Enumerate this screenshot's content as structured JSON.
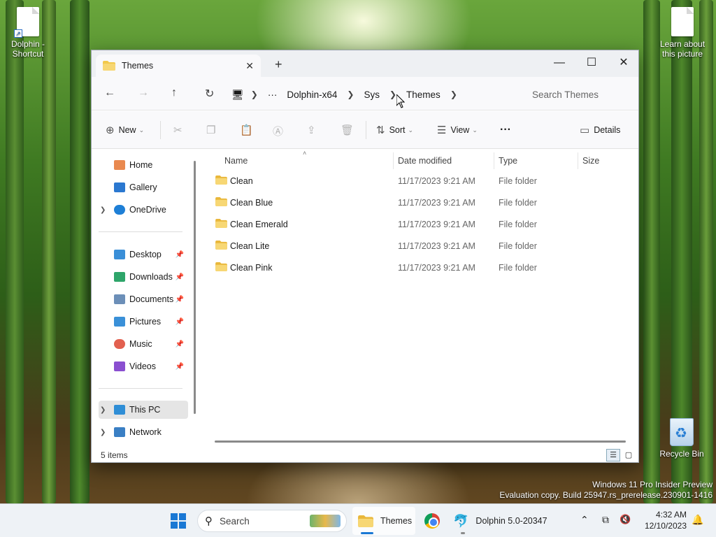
{
  "desktop": {
    "icons": [
      {
        "label": "Dolphin - Shortcut"
      },
      {
        "label": "Learn about this picture"
      }
    ],
    "recycle_bin": "Recycle Bin",
    "watermark_line1": "Windows 11 Pro Insider Preview",
    "watermark_line2": "Evaluation copy. Build 25947.rs_prerelease.230901-1416"
  },
  "explorer": {
    "tab_title": "Themes",
    "new_tab": "+",
    "window_buttons": {
      "minimize": "—",
      "maximize": "☐",
      "close": "✕"
    },
    "address": {
      "overflow": "···",
      "segments": [
        "Dolphin-x64",
        "Sys",
        "Themes"
      ]
    },
    "search_placeholder": "Search Themes",
    "toolbar": {
      "new": "New",
      "sort": "Sort",
      "view": "View",
      "more": "···",
      "details": "Details"
    },
    "sidebar": {
      "items": [
        {
          "label": "Home",
          "icon": "home-icon"
        },
        {
          "label": "Gallery",
          "icon": "gallery-icon"
        },
        {
          "label": "OneDrive",
          "icon": "onedrive-icon"
        },
        {
          "label": "Desktop",
          "icon": "desktop-icon"
        },
        {
          "label": "Downloads",
          "icon": "downloads-icon"
        },
        {
          "label": "Documents",
          "icon": "documents-icon"
        },
        {
          "label": "Pictures",
          "icon": "pictures-icon"
        },
        {
          "label": "Music",
          "icon": "music-icon"
        },
        {
          "label": "Videos",
          "icon": "videos-icon"
        },
        {
          "label": "This PC",
          "icon": "this-pc-icon"
        },
        {
          "label": "Network",
          "icon": "network-icon"
        }
      ]
    },
    "columns": {
      "name": "Name",
      "date": "Date modified",
      "type": "Type",
      "size": "Size"
    },
    "files": [
      {
        "name": "Clean",
        "date": "11/17/2023 9:21 AM",
        "type": "File folder"
      },
      {
        "name": "Clean Blue",
        "date": "11/17/2023 9:21 AM",
        "type": "File folder"
      },
      {
        "name": "Clean Emerald",
        "date": "11/17/2023 9:21 AM",
        "type": "File folder"
      },
      {
        "name": "Clean Lite",
        "date": "11/17/2023 9:21 AM",
        "type": "File folder"
      },
      {
        "name": "Clean Pink",
        "date": "11/17/2023 9:21 AM",
        "type": "File folder"
      }
    ],
    "status": "5 items"
  },
  "taskbar": {
    "search": "Search",
    "apps": [
      {
        "label": "Themes"
      },
      {
        "label": "Dolphin 5.0-20347"
      }
    ],
    "time": "4:32 AM",
    "date": "12/10/2023"
  },
  "colors": {
    "accent": "#1a78d4",
    "folder": "#f2c94c"
  }
}
